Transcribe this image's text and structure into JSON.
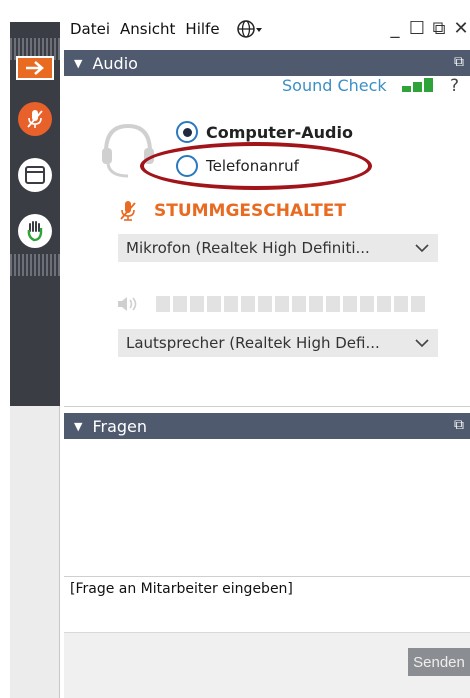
{
  "menu": {
    "items": [
      {
        "label": "Datei"
      },
      {
        "label": "Ansicht"
      },
      {
        "label": "Hilfe"
      }
    ],
    "globe_icon": "globe-icon",
    "window_controls": [
      "_",
      "☐",
      "⧉",
      "✕"
    ]
  },
  "audio": {
    "title": "Audio",
    "sound_check": "Sound Check",
    "help": "?",
    "options": [
      {
        "label": "Computer-Audio",
        "selected": true
      },
      {
        "label": "Telefonanruf",
        "selected": false
      }
    ],
    "mute_status": "STUMMGESCHALTET",
    "microphone": "Mikrofon (Realtek High Definiti...",
    "speaker": "Lautsprecher (Realtek High Defi...",
    "signal_bars": 3,
    "speaker_level_segments": 16
  },
  "fragen": {
    "title": "Fragen",
    "input_text": "[Frage an Mitarbeiter eingeben]",
    "send_label": "Senden"
  },
  "colors": {
    "accent_orange": "#e86b21",
    "header_bg": "#4f5a6e",
    "link_blue": "#3b8fc7",
    "signal_green": "#2ea33a",
    "highlight_red": "#a0141a"
  }
}
